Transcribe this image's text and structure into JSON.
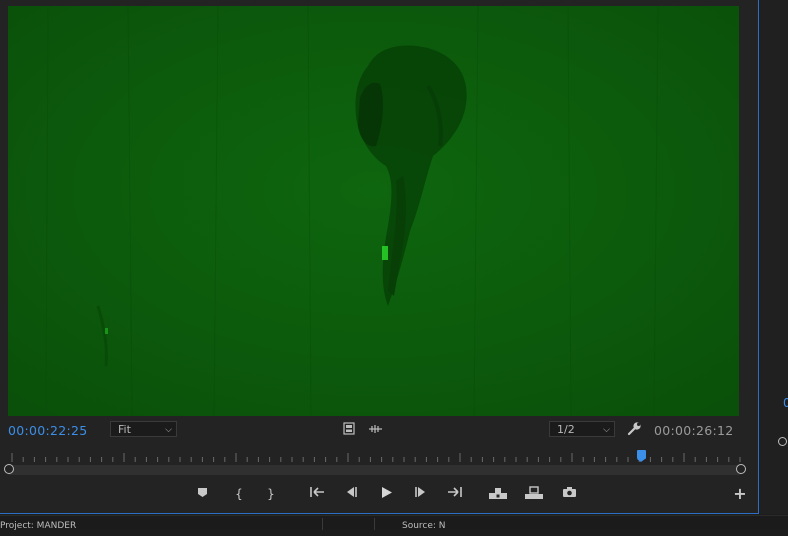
{
  "monitor": {
    "current_timecode": "00:00:22:25",
    "duration_timecode": "00:00:26:12",
    "zoom_select": "Fit",
    "resolution_select": "1/2",
    "playhead_fraction": 0.864
  },
  "icons": {
    "safe_margins": "film-frame-icon",
    "multi_cam": "audio-wave-icon",
    "settings": "wrench-icon"
  },
  "transport": {
    "add_marker": "⬟",
    "mark_in": "{",
    "mark_out": "}",
    "go_to_in": "{←",
    "step_back": "◀|",
    "play": "▶",
    "step_forward": "|▶",
    "go_to_out": "→}",
    "insert": "insert-icon",
    "overwrite": "overwrite-icon",
    "export_frame": "camera-icon",
    "add": "+"
  },
  "bottom_bar": {
    "left_text": "Project: MANDER",
    "right_text": "Source: N"
  },
  "colors": {
    "accent_blue": "#3b8fe8",
    "video_green": "#0b5a0b"
  }
}
